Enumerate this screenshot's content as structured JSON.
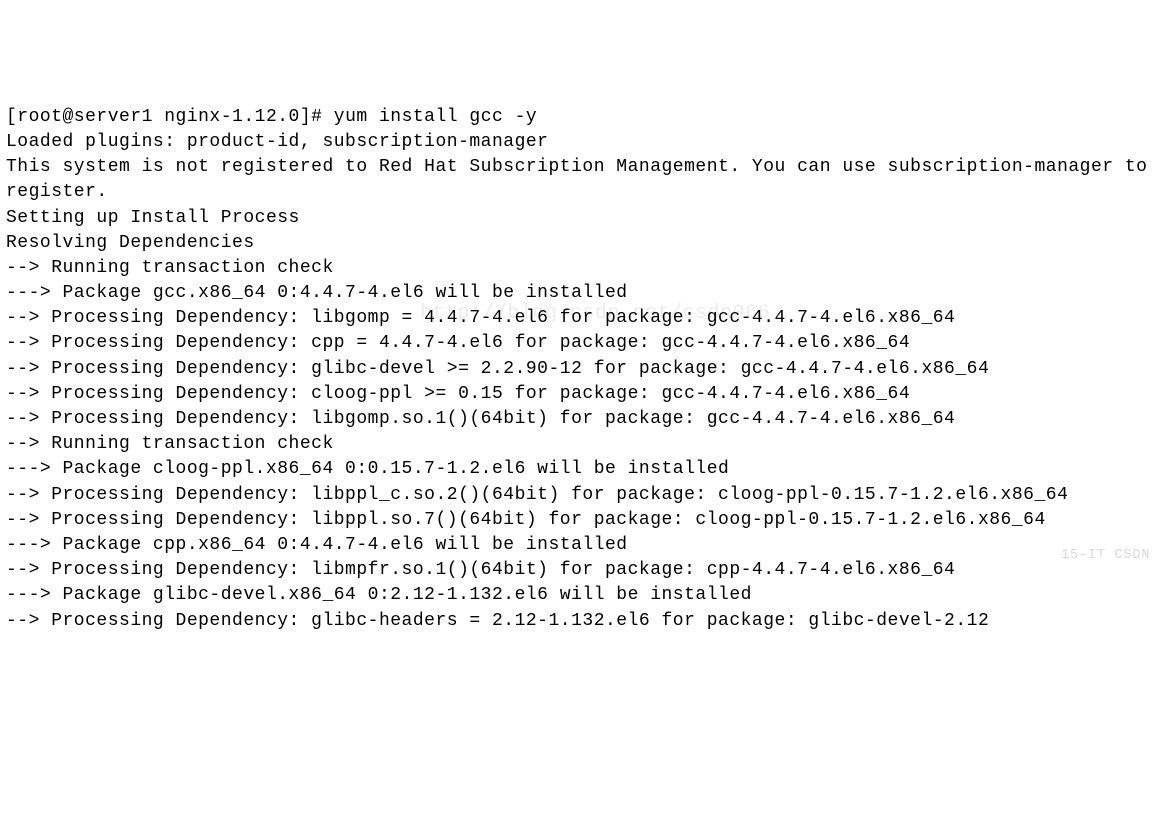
{
  "terminal": {
    "prompt": "[root@server1 nginx-1.12.0]# ",
    "command": "yum install gcc -y",
    "lines": [
      "Loaded plugins: product-id, subscription-manager",
      "This system is not registered to Red Hat Subscription Management. You can use subscription-manager to register.",
      "Setting up Install Process",
      "Resolving Dependencies",
      "--> Running transaction check",
      "---> Package gcc.x86_64 0:4.4.7-4.el6 will be installed",
      "--> Processing Dependency: libgomp = 4.4.7-4.el6 for package: gcc-4.4.7-4.el6.x86_64",
      "--> Processing Dependency: cpp = 4.4.7-4.el6 for package: gcc-4.4.7-4.el6.x86_64",
      "--> Processing Dependency: glibc-devel >= 2.2.90-12 for package: gcc-4.4.7-4.el6.x86_64",
      "--> Processing Dependency: cloog-ppl >= 0.15 for package: gcc-4.4.7-4.el6.x86_64",
      "--> Processing Dependency: libgomp.so.1()(64bit) for package: gcc-4.4.7-4.el6.x86_64",
      "--> Running transaction check",
      "---> Package cloog-ppl.x86_64 0:0.15.7-1.2.el6 will be installed",
      "--> Processing Dependency: libppl_c.so.2()(64bit) for package: cloog-ppl-0.15.7-1.2.el6.x86_64",
      "--> Processing Dependency: libppl.so.7()(64bit) for package: cloog-ppl-0.15.7-1.2.el6.x86_64",
      "---> Package cpp.x86_64 0:4.4.7-4.el6 will be installed",
      "--> Processing Dependency: libmpfr.so.1()(64bit) for package: cpp-4.4.7-4.el6.x86_64",
      "---> Package glibc-devel.x86_64 0:2.12-1.132.el6 will be installed",
      "--> Processing Dependency: glibc-headers = 2.12-1.132.el6 for package: glibc-devel-2.12"
    ]
  },
  "watermark_center": "http://blog.csdn.net/csdn066",
  "watermark_corner": "15-IT CSDN"
}
